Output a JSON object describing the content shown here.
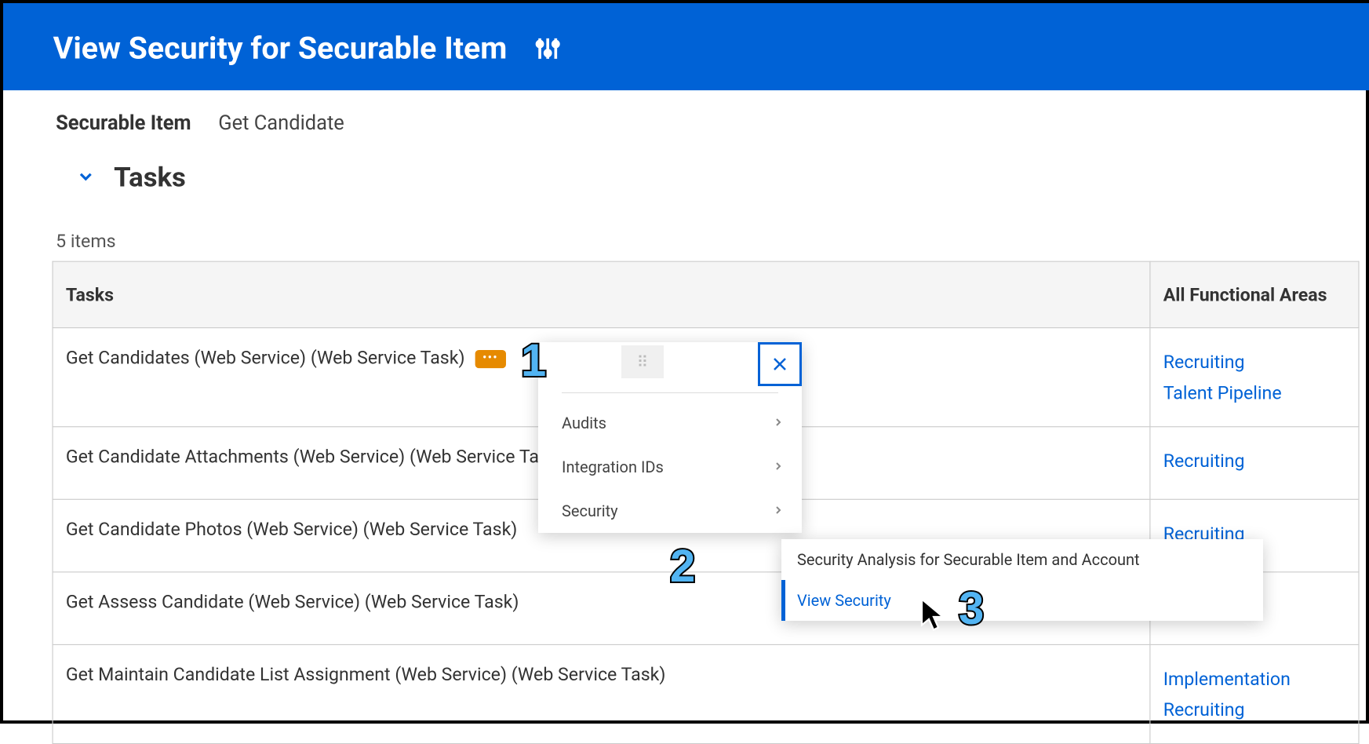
{
  "header": {
    "title": "View Security for Securable Item"
  },
  "field": {
    "label": "Securable Item",
    "value": "Get Candidate"
  },
  "section": {
    "title": "Tasks",
    "count": "5 items"
  },
  "table": {
    "columns": {
      "tasks": "Tasks",
      "areas": "All Functional Areas"
    },
    "rows": [
      {
        "task": "Get Candidates (Web Service) (Web Service Task)",
        "has_related_badge": true,
        "areas": [
          "Recruiting",
          "Talent Pipeline"
        ]
      },
      {
        "task": "Get Candidate Attachments (Web Service) (Web Service Task)",
        "areas": [
          "Recruiting"
        ]
      },
      {
        "task": "Get Candidate Photos (Web Service) (Web Service Task)",
        "areas": [
          "Recruiting"
        ]
      },
      {
        "task": "Get Assess Candidate (Web Service) (Web Service Task)",
        "areas": []
      },
      {
        "task": "Get Maintain Candidate List Assignment (Web Service) (Web Service Task)",
        "areas": [
          "Implementation",
          "Recruiting"
        ]
      }
    ]
  },
  "popup": {
    "items": [
      "Audits",
      "Integration IDs",
      "Security"
    ]
  },
  "submenu": {
    "items": [
      {
        "label": "Security Analysis for Securable Item and Account",
        "active": false
      },
      {
        "label": "View Security",
        "active": true
      }
    ]
  },
  "callouts": [
    "1",
    "2",
    "3"
  ]
}
